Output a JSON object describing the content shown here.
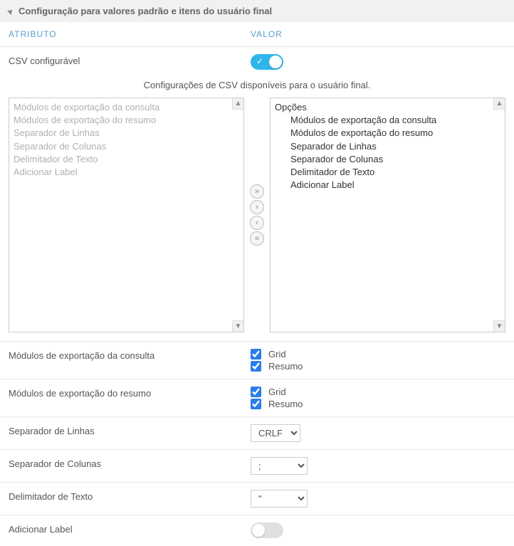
{
  "panel": {
    "title": "Configuração para valores padrão e itens do usuário final"
  },
  "headers": {
    "attribute": "ATRIBUTO",
    "value": "VALOR"
  },
  "csv_configurable": {
    "label": "CSV configurável",
    "on": true
  },
  "subtitle": "Configurações de CSV disponíveis para o usuário final.",
  "left_list": [
    "Módulos de exportação da consulta",
    "Módulos de exportação do resumo",
    "Separador de Linhas",
    "Separador de Colunas",
    "Delimitador de Texto",
    "Adicionar Label"
  ],
  "right_list": {
    "root": "Opções",
    "children": [
      "Módulos de exportação da consulta",
      "Módulos de exportação do resumo",
      "Separador de Linhas",
      "Separador de Colunas",
      "Delimitador de Texto",
      "Adicionar Label"
    ]
  },
  "mod_consulta": {
    "label": "Módulos de exportação da consulta",
    "opt1": "Grid",
    "opt2": "Resumo"
  },
  "mod_resumo": {
    "label": "Módulos de exportação do resumo",
    "opt1": "Grid",
    "opt2": "Resumo"
  },
  "sep_linhas": {
    "label": "Separador de Linhas",
    "value": "CRLF"
  },
  "sep_colunas": {
    "label": "Separador de Colunas",
    "value": ";"
  },
  "delim_texto": {
    "label": "Delimitador de Texto",
    "value": "\""
  },
  "add_label": {
    "label": "Adicionar Label",
    "on": false
  }
}
